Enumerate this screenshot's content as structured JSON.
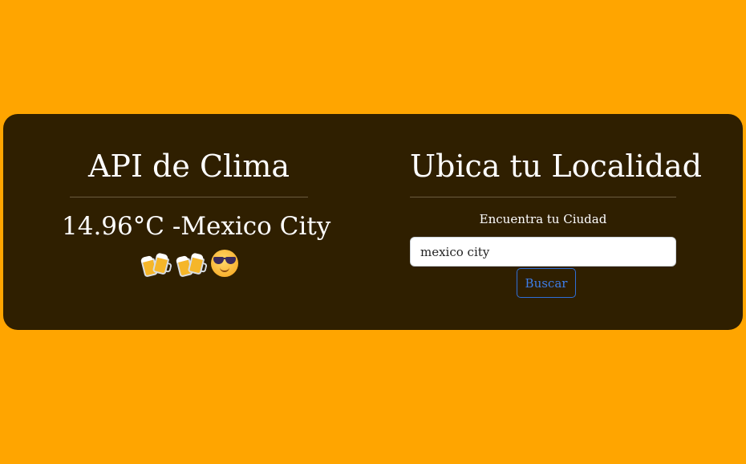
{
  "weather": {
    "title": "API de Clima",
    "result": "14.96°C -Mexico City",
    "icons": [
      "beer-icon",
      "beer-icon",
      "cool-face-icon"
    ]
  },
  "search": {
    "title": "Ubica tu Localidad",
    "label": "Encuentra tu Ciudad",
    "value": "mexico city",
    "button_label": "Buscar"
  },
  "colors": {
    "page_background": "#FFA500",
    "card_background": "#2F1F00",
    "button_accent": "#2F6FD8"
  }
}
